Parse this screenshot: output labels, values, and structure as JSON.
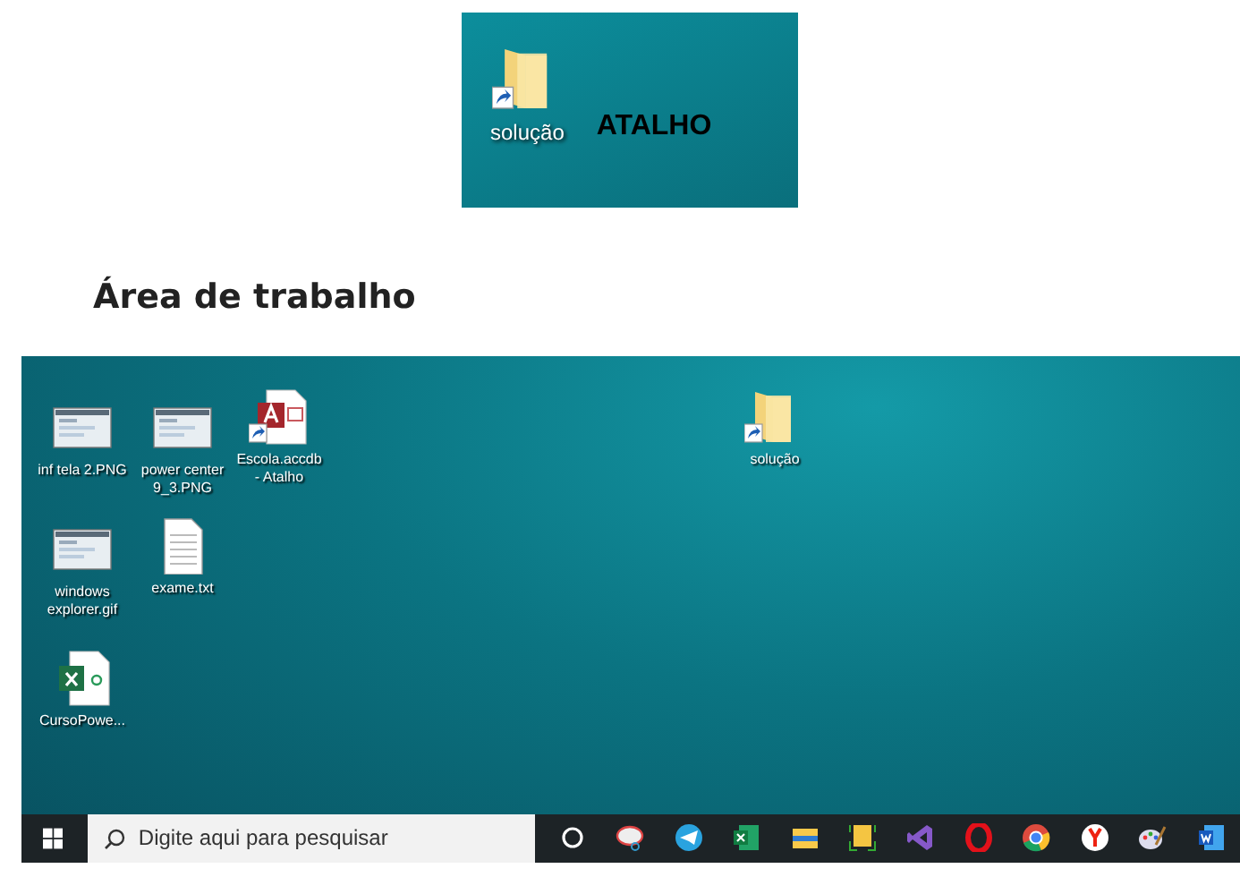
{
  "shortcut_preview": {
    "icon_label": "solução",
    "shortcut": true,
    "caption": "ATALHO"
  },
  "heading": "Área de trabalho",
  "desktop": {
    "icons": [
      {
        "label": "inf tela 2.PNG",
        "kind": "image",
        "shortcut": false
      },
      {
        "label": "power center 9_3.PNG",
        "kind": "image",
        "shortcut": false
      },
      {
        "label": "Escola.accdb - Atalho",
        "kind": "access",
        "shortcut": true
      },
      {
        "label": "windows explorer.gif",
        "kind": "image",
        "shortcut": false
      },
      {
        "label": "exame.txt",
        "kind": "text",
        "shortcut": false
      },
      {
        "label": "CursoPowe...",
        "kind": "excel",
        "shortcut": false
      },
      {
        "label": "solução",
        "kind": "folder",
        "shortcut": true
      }
    ]
  },
  "taskbar": {
    "search": {
      "placeholder": "Digite aqui para pesquisar"
    }
  }
}
